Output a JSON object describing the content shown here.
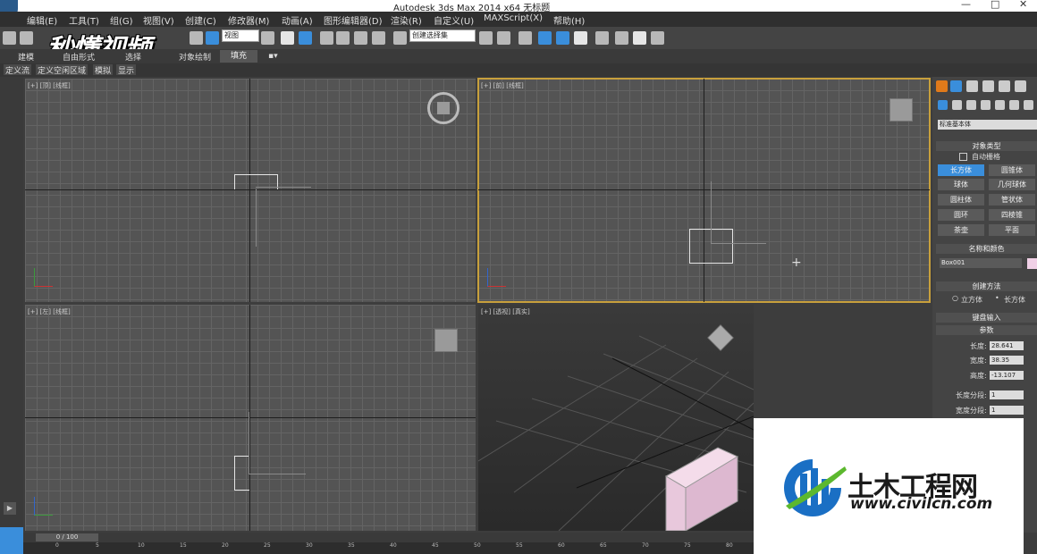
{
  "window": {
    "title": "Autodesk 3ds Max  2014 x64      无标题",
    "controls": [
      "—",
      "□",
      "✕"
    ]
  },
  "menu": [
    "编辑(E)",
    "工具(T)",
    "组(G)",
    "视图(V)",
    "创建(C)",
    "修改器(M)",
    "动画(A)",
    "图形编辑器(D)",
    "渲染(R)",
    "自定义(U)",
    "MAXScript(X)",
    "帮助(H)"
  ],
  "toolbar": {
    "view_dropdown": "视图",
    "selection_set": "创建选择集"
  },
  "ribbon": {
    "tabs": [
      "建模",
      "自由形式",
      "选择",
      "对象绘制"
    ],
    "fill_button": "填充",
    "subtabs": [
      "定义流",
      "定义空闲区域",
      "模拟",
      "显示"
    ]
  },
  "watermark": "秒懂视频",
  "viewports": {
    "top": "[+] [顶] [线框]",
    "front": "[+] [前] [线框]",
    "left": "[+] [左] [线框]",
    "perspective": "[+] [透视] [真实]"
  },
  "command_panel": {
    "dropdown": "标准基本体",
    "object_type": {
      "title": "对象类型",
      "autogrid": "自动栅格",
      "buttons": [
        "长方体",
        "圆锥体",
        "球体",
        "几何球体",
        "圆柱体",
        "管状体",
        "圆环",
        "四棱锥",
        "茶壶",
        "平面"
      ]
    },
    "name_color": {
      "title": "名称和颜色",
      "name": "Box001"
    },
    "creation_method": {
      "title": "创建方法",
      "options": [
        "立方体",
        "长方体"
      ]
    },
    "keyboard_entry": "键盘输入",
    "params": {
      "title": "参数",
      "length_label": "长度:",
      "length": "28.641",
      "width_label": "宽度:",
      "width": "38.35",
      "height_label": "高度:",
      "height": "-13.107",
      "length_segs_label": "长度分段:",
      "length_segs": "1",
      "width_segs_label": "宽度分段:",
      "width_segs": "1"
    }
  },
  "timeline": {
    "slider": "0 / 100",
    "ticks": [
      "0",
      "5",
      "10",
      "15",
      "20",
      "25",
      "30",
      "35",
      "40",
      "45",
      "50",
      "55",
      "60",
      "65",
      "70",
      "75",
      "80"
    ]
  },
  "logo": {
    "text": "土木工程网",
    "url": "www.civilcn.com"
  },
  "colors": {
    "accent": "#3a8edb",
    "box_color": "#f0d0e6",
    "viewport_active_border": "#c8a03c"
  }
}
